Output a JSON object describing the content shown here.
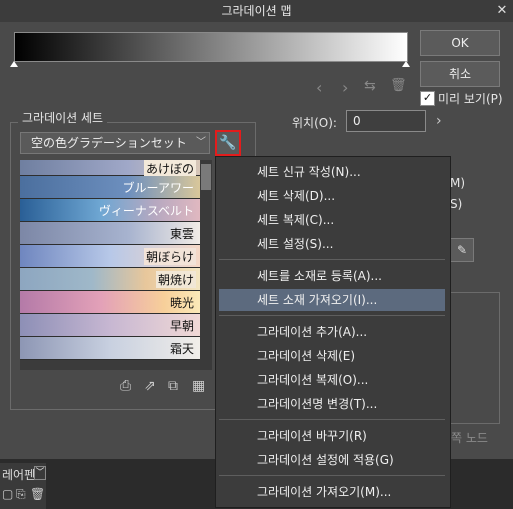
{
  "window": {
    "title": "그라데이션 맵",
    "close": "✕"
  },
  "buttons": {
    "ok": "OK",
    "cancel": "취소"
  },
  "preview": {
    "label": "미리 보기(P)",
    "checked": "✓"
  },
  "nav": {
    "prev": "‹",
    "next": "›",
    "swap": "⇆",
    "delete": "🗑"
  },
  "set_section": {
    "label": "그라데이션 세트",
    "selected_set": "空の色グラデーションセット",
    "dropdown_arrow": "﹀",
    "wrench": "🔧"
  },
  "gradients": [
    {
      "name": "あけぼの"
    },
    {
      "name": "ブルーアワー"
    },
    {
      "name": "ヴィーナスベルト"
    },
    {
      "name": "東雲"
    },
    {
      "name": "朝ぼらけ"
    },
    {
      "name": "朝焼け"
    },
    {
      "name": "暁光"
    },
    {
      "name": "早朝"
    },
    {
      "name": "霜天"
    }
  ],
  "bottom_icons": [
    "⎙",
    "⇗",
    "⧉",
    "▦"
  ],
  "position": {
    "label": "위치(O):",
    "value": "0",
    "arrow": "›"
  },
  "right_fragments": {
    "m": "M)",
    "s": "S)",
    "node": "른쪽 노드"
  },
  "eyedropper": "✎",
  "menu": {
    "items": [
      {
        "label": "세트 신규 작성(N)..."
      },
      {
        "label": "세트 삭제(D)..."
      },
      {
        "label": "세트 복제(C)..."
      },
      {
        "label": "세트 설정(S)..."
      },
      {
        "label": "세트를 소재로 등록(A)..."
      },
      {
        "label": "세트 소재 가져오기(I)..."
      },
      {
        "label": "그라데이션 추가(A)..."
      },
      {
        "label": "그라데이션 삭제(E)"
      },
      {
        "label": "그라데이션 복제(O)..."
      },
      {
        "label": "그라데이션명 변경(T)..."
      },
      {
        "label": "그라데이션 바꾸기(R)"
      },
      {
        "label": "그라데이션 설정에 적용(G)"
      },
      {
        "label": "그라데이션 가져오기(M)..."
      }
    ]
  },
  "outside": {
    "layer_label": "레어펜",
    "icons": [
      "▢",
      "⎘",
      "🗑"
    ]
  }
}
